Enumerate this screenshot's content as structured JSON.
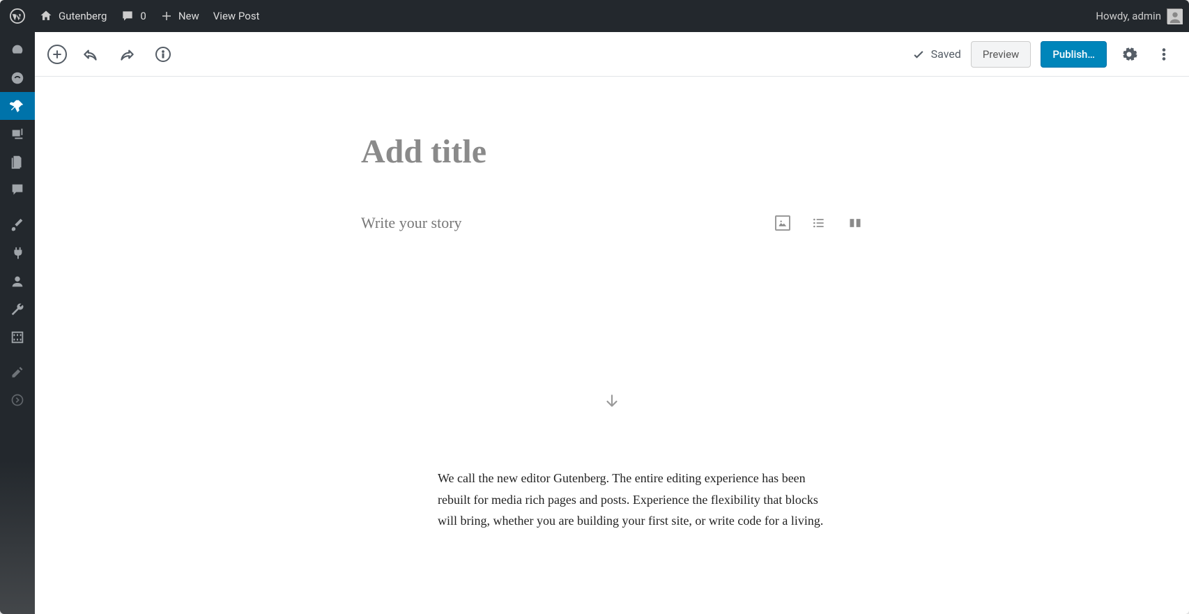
{
  "admin_bar": {
    "site_name": "Gutenberg",
    "comments_count": "0",
    "new_label": "New",
    "view_post_label": "View Post",
    "howdy": "Howdy, admin"
  },
  "toolbar": {
    "saved_label": "Saved",
    "preview_label": "Preview",
    "publish_label": "Publish…"
  },
  "editor": {
    "title_placeholder": "Add title",
    "story_placeholder": "Write your story",
    "intro_paragraph": "We call the new editor Gutenberg. The entire editing experience has been rebuilt for media rich pages and posts. Experience the flexibility that blocks will bring, whether you are building your first site, or write code for a living."
  },
  "colors": {
    "primary": "#0085ba",
    "admin_dark": "#23282d"
  }
}
